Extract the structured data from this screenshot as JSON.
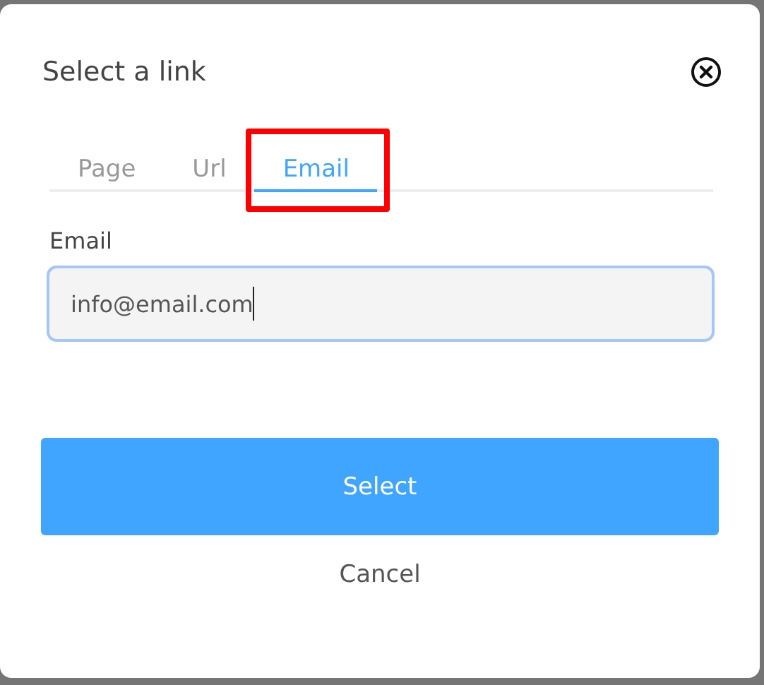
{
  "dialog": {
    "title": "Select a link"
  },
  "tabs": [
    {
      "label": "Page",
      "selected": false,
      "highlighted": false
    },
    {
      "label": "Url",
      "selected": false,
      "highlighted": false
    },
    {
      "label": "Email",
      "selected": true,
      "highlighted": true
    }
  ],
  "field": {
    "label": "Email",
    "value": "info@email.com",
    "focused": true
  },
  "buttons": [
    {
      "label": "Select",
      "kind": "primary"
    },
    {
      "label": "Cancel",
      "kind": "plain"
    }
  ]
}
